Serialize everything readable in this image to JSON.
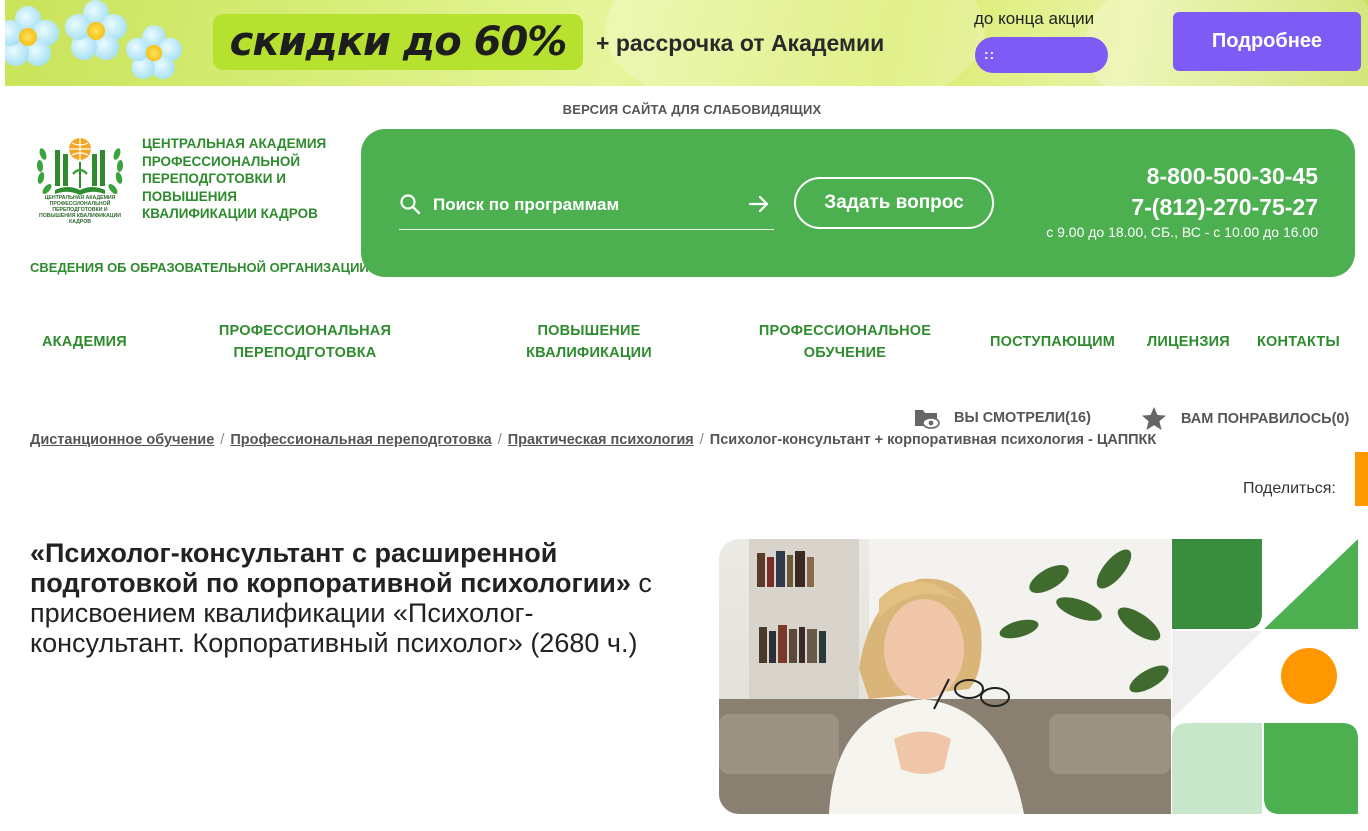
{
  "promo": {
    "discount": "скидки до 60%",
    "subtitle": "+ рассрочка от Академии",
    "until_label": "до конца акции",
    "timer": "::",
    "button": "Подробнее",
    "colors": {
      "accent": "#7c5cf4",
      "pill": "#b7e12f"
    }
  },
  "header": {
    "accessibility_link": "ВЕРСИЯ САЙТА ДЛЯ СЛАБОВИДЯЩИХ",
    "logo_text": "ЦЕНТРАЛЬНАЯ АКАДЕМИЯ ПРОФЕССИОНАЛЬНОЙ ПЕРЕПОДГОТОВКИ И ПОВЫШЕНИЯ КВАЛИФИКАЦИИ КАДРОВ",
    "logo_emblem_text": "ЦЕНТРАЛЬНАЯ АКАДЕМИЯ ПРОФЕССИОНАЛЬНОЙ ПЕРЕПОДГОТОВКИ И ПОВЫШЕНИЯ КВАЛИФИКАЦИИ КАДРОВ",
    "org_info": "СВЕДЕНИЯ ОБ ОБРАЗОВАТЕЛЬНОЙ ОРГАНИЗАЦИИ",
    "search_placeholder": "Поиск по программам",
    "ask_button": "Задать вопрос",
    "phone_1": "8-800-500-30-45",
    "phone_2": "7-(812)-270-75-27",
    "hours": "с 9.00 до 18.00, СБ., ВС - с 10.00 до 16.00",
    "colors": {
      "brand_green": "#4caf50",
      "text_green": "#2e8b2e"
    }
  },
  "nav": {
    "items": [
      {
        "label": "АКАДЕМИЯ"
      },
      {
        "label": "ПРОФЕССИОНАЛЬНАЯ ПЕРЕПОДГОТОВКА"
      },
      {
        "label": "ПОВЫШЕНИЕ КВАЛИФИКАЦИИ"
      },
      {
        "label": "ПРОФЕССИОНАЛЬНОЕ ОБУЧЕНИЕ"
      },
      {
        "label": "ПОСТУПАЮЩИМ"
      },
      {
        "label": "ЛИЦЕНЗИЯ"
      },
      {
        "label": "КОНТАКТЫ"
      }
    ]
  },
  "user_lists": {
    "watched": "ВЫ СМОТРЕЛИ(16)",
    "liked": "ВАМ ПОНРАВИЛОСЬ(0)"
  },
  "breadcrumbs": [
    {
      "label": "Дистанционное обучение",
      "link": true
    },
    {
      "label": "Профессиональная переподготовка",
      "link": true
    },
    {
      "label": "Практическая психология",
      "link": true
    },
    {
      "label": "Психолог-консультант + корпоративная психология - ЦАППКК",
      "link": false
    }
  ],
  "share": {
    "label": "Поделиться:"
  },
  "course": {
    "title_bold": "«Психолог-консультант с расширенной подготовкой по корпоративной психологии»",
    "title_rest": " с присвоением квалификации «Психолог-консультант. Корпоративный психолог» (2680 ч.)"
  }
}
